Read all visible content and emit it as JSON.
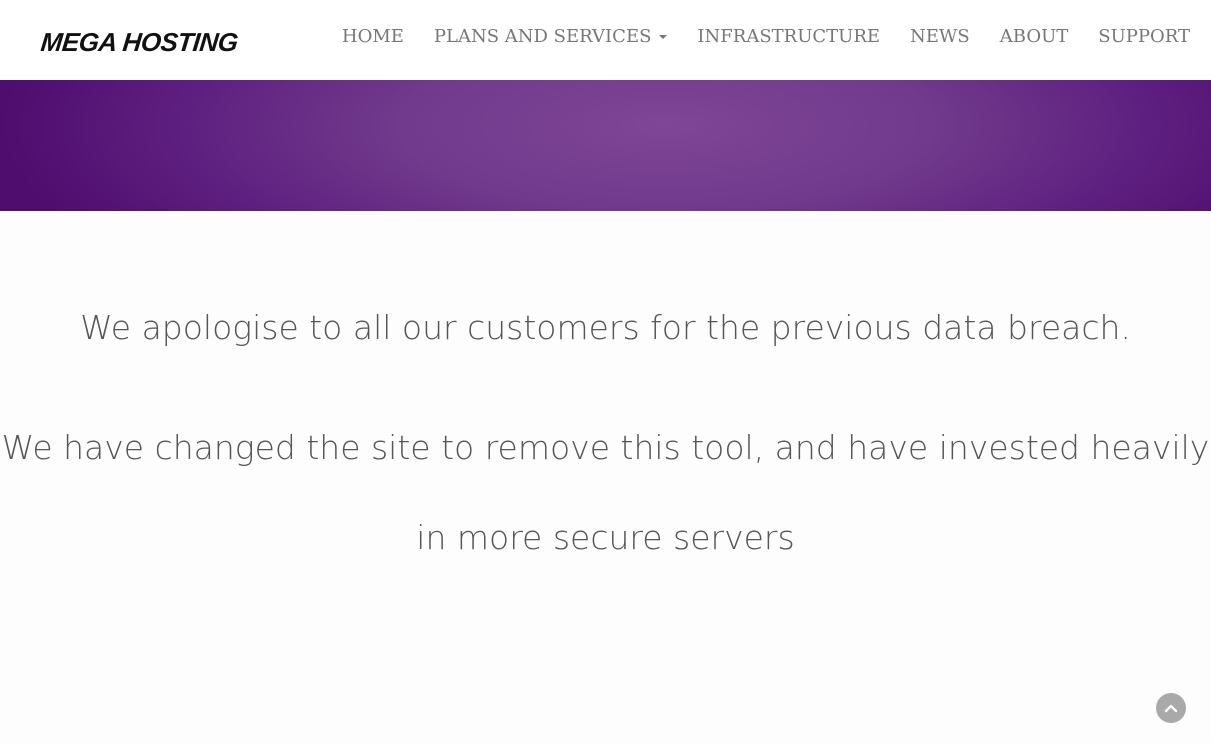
{
  "brand": {
    "name": "MEGA HOSTING"
  },
  "nav": {
    "items": [
      {
        "label": "HOME"
      },
      {
        "label": "PLANS AND SERVICES",
        "has_dropdown": true
      },
      {
        "label": "INFRASTRUCTURE"
      },
      {
        "label": "NEWS"
      },
      {
        "label": "ABOUT"
      },
      {
        "label": "SUPPORT"
      }
    ]
  },
  "hero": {
    "gradient_center": "#7f4596",
    "gradient_edge": "#4f0d6e"
  },
  "main": {
    "apology": "We apologise to all our customers for the previous data breach.",
    "statement_line1": "We have changed the site to remove this tool, and have invested heavily",
    "statement_line2": "in more secure servers"
  },
  "scroll_top": {
    "icon": "chevron-up-icon",
    "color": "#a9a9a9"
  }
}
